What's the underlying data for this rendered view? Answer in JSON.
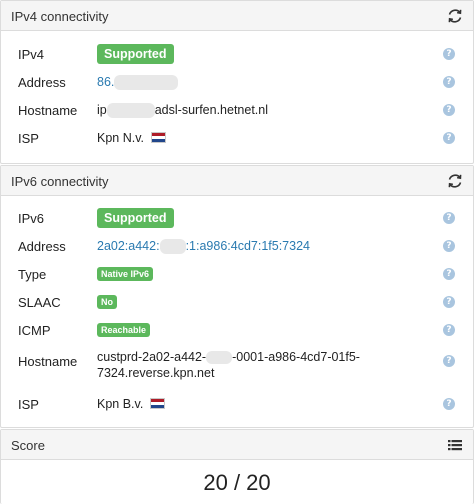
{
  "ipv4": {
    "title": "IPv4 connectivity",
    "rows": {
      "ipv4": {
        "label": "IPv4",
        "badge": "Supported"
      },
      "address": {
        "label": "Address",
        "value_prefix": "86."
      },
      "hostname": {
        "label": "Hostname",
        "value_prefix": "ip",
        "value_suffix": "adsl-surfen.hetnet.nl"
      },
      "isp": {
        "label": "ISP",
        "value": "Kpn N.v."
      }
    }
  },
  "ipv6": {
    "title": "IPv6 connectivity",
    "rows": {
      "ipv6": {
        "label": "IPv6",
        "badge": "Supported"
      },
      "address": {
        "label": "Address",
        "value_prefix": "2a02:a442:",
        "value_suffix": ":1:a986:4cd7:1f5:7324"
      },
      "type": {
        "label": "Type",
        "badge": "Native IPv6"
      },
      "slaac": {
        "label": "SLAAC",
        "badge": "No"
      },
      "icmp": {
        "label": "ICMP",
        "badge": "Reachable"
      },
      "hostname": {
        "label": "Hostname",
        "value_prefix": "custprd-2a02-a442-",
        "value_suffix": "-0001-a986-4cd7-01f5-7324.reverse.kpn.net"
      },
      "isp": {
        "label": "ISP",
        "value": "Kpn B.v."
      }
    }
  },
  "score": {
    "title": "Score",
    "value": "20 / 20"
  },
  "help_glyph": "?",
  "icons": {
    "refresh": "refresh-icon",
    "list": "list-icon",
    "help": "help-icon",
    "flag": "netherlands-flag-icon"
  },
  "colors": {
    "success": "#5cb85c",
    "link": "#2a7ab0",
    "help": "#a9c5df",
    "header_bg": "#f5f5f5",
    "flag_red": "#ae1c28",
    "flag_white": "#ffffff",
    "flag_blue": "#21468b"
  }
}
